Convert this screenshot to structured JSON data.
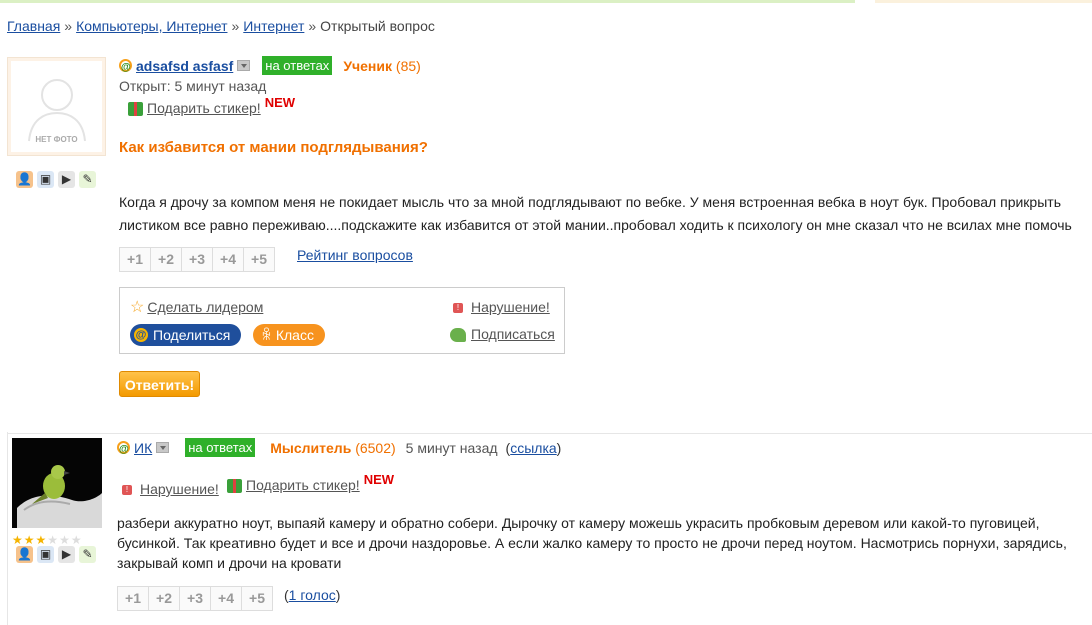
{
  "breadcrumbs": [
    "Главная",
    "Компьютеры, Интернет",
    "Интернет"
  ],
  "breadcrumb_current": "Открытый вопрос",
  "breadcrumb_sep": "»",
  "question": {
    "avatar_placeholder": "НЕТ ФОТО",
    "username": "adsafsd asfasf",
    "badge": "на ответах",
    "rank": "Ученик",
    "points": "(85)",
    "opened": "Открыт: 5 минут назад",
    "gift_link": "Подарить стикер!",
    "new_label": "NEW",
    "title": "Как избавится от мании подглядывания?",
    "body": "Когда я дрочу за компом меня не покидает мысль что за мной подглядывают по вебке. У меня встроенная вебка в ноут бук. Пробовал прикрыть листиком все равно переживаю....подскажите как избавится от этой мании..пробовал ходить к психологу он мне сказал что не всилах мне помочь",
    "votes": [
      "+1",
      "+2",
      "+3",
      "+4",
      "+5"
    ],
    "rating_link": "Рейтинг вопросов",
    "make_leader": "Сделать лидером",
    "violation": "Нарушение!",
    "share": "Поделиться",
    "klass": "Класс",
    "subscribe": "Подписаться",
    "answer_button": "Ответить!"
  },
  "answer": {
    "username": "ИК",
    "badge": "на ответах",
    "rank": "Мыслитель",
    "points": "(6502)",
    "time": "5 минут назад",
    "link_open": "(",
    "link_text": "ссылка",
    "link_close": ")",
    "violation": "Нарушение!",
    "gift_link": "Подарить стикер!",
    "new_label": "NEW",
    "body": "разбери аккуратно ноут, выпаяй камеру и обратно собери. Дырочку от камеру можешь украсить пробковым деревом или какой-то пуговицей, бусинкой. Так креативно будет и все и дрочи наздоровье. А если жалко камеру то просто не дрочи перед ноутом. Насмотрись порнухи, зарядись, закрывай комп и дрочи на кровати",
    "votes": [
      "+1",
      "+2",
      "+3",
      "+4",
      "+5"
    ],
    "votes_count_open": "(",
    "votes_count": "1 голос",
    "votes_count_close": ")",
    "stars_on": 3,
    "stars_total": 6
  },
  "colors": {
    "accent": "#f07000",
    "link": "#1a4ea0",
    "badge": "#2fb02a",
    "new": "#e00000"
  }
}
